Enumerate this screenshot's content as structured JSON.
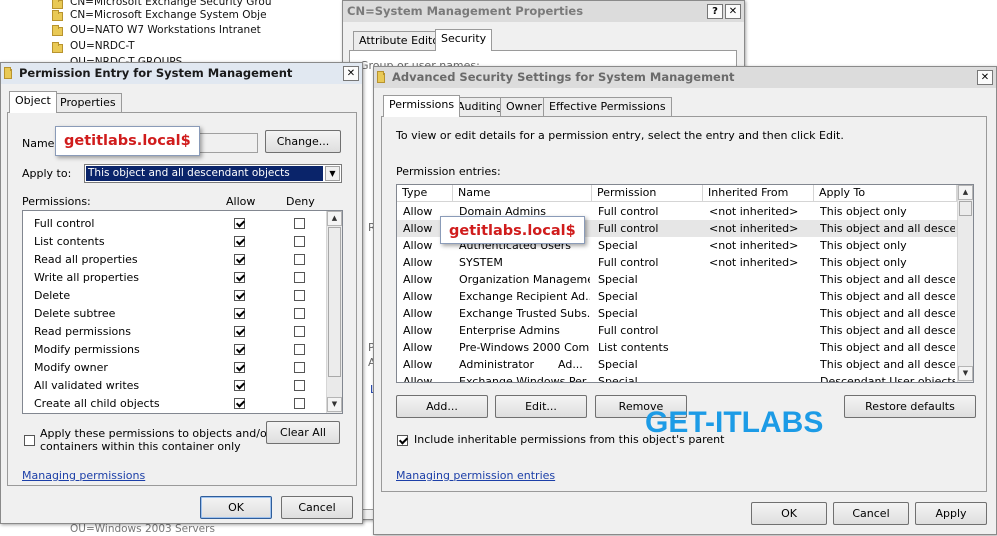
{
  "background_tree": {
    "items": [
      "CN=Microsoft Exchange Security Grou",
      "CN=Microsoft Exchange System Obje",
      "OU=NATO W7 Workstations Intranet",
      "OU=NRDC-T",
      "OU=NRDC-T GROUPS"
    ],
    "bottom_item": "OU=Windows 2003 Servers"
  },
  "back_dialog": {
    "title": "CN=System Management Properties",
    "tabs": [
      "Attribute Editor",
      "Security"
    ],
    "group_label": "Group or user names:"
  },
  "perm_entry": {
    "title": "Permission Entry for System Management",
    "tabs": [
      "Object",
      "Properties"
    ],
    "name_label": "Name:",
    "name_value": "getitlabs.local$",
    "change_button": "Change...",
    "apply_to_label": "Apply to:",
    "apply_to_value": "This object and all descendant objects",
    "permissions_label": "Permissions:",
    "allow_header": "Allow",
    "deny_header": "Deny",
    "permissions": [
      {
        "name": "Full control",
        "allow": true,
        "deny": false
      },
      {
        "name": "List contents",
        "allow": true,
        "deny": false
      },
      {
        "name": "Read all properties",
        "allow": true,
        "deny": false
      },
      {
        "name": "Write all properties",
        "allow": true,
        "deny": false
      },
      {
        "name": "Delete",
        "allow": true,
        "deny": false
      },
      {
        "name": "Delete subtree",
        "allow": true,
        "deny": false
      },
      {
        "name": "Read permissions",
        "allow": true,
        "deny": false
      },
      {
        "name": "Modify permissions",
        "allow": true,
        "deny": false
      },
      {
        "name": "Modify owner",
        "allow": true,
        "deny": false
      },
      {
        "name": "All validated writes",
        "allow": true,
        "deny": false
      },
      {
        "name": "Create all child objects",
        "allow": true,
        "deny": false
      }
    ],
    "apply_checkbox_label_1": "Apply these permissions to objects and/or",
    "apply_checkbox_label_2": "containers within this container only",
    "clear_all_button": "Clear All",
    "managing_link": "Managing permissions",
    "ok_button": "OK",
    "cancel_button": "Cancel"
  },
  "advanced": {
    "title": "Advanced Security Settings for System Management",
    "tabs": [
      "Permissions",
      "Auditing",
      "Owner",
      "Effective Permissions"
    ],
    "instructions": "To view or edit details for a permission entry, select the entry and then click Edit.",
    "entries_label": "Permission entries:",
    "columns": [
      "Type",
      "Name",
      "Permission",
      "Inherited From",
      "Apply To"
    ],
    "rows": [
      {
        "type": "Allow",
        "name": "Domain Admins",
        "permission": "Full control",
        "inherited": "<not inherited>",
        "apply": "This object only"
      },
      {
        "type": "Allow",
        "name": "",
        "permission": "Full control",
        "inherited": "<not inherited>",
        "apply": "This object and all desce..."
      },
      {
        "type": "Allow",
        "name": "Authenticated Users",
        "permission": "Special",
        "inherited": "<not inherited>",
        "apply": "This object only"
      },
      {
        "type": "Allow",
        "name": "SYSTEM",
        "permission": "Full control",
        "inherited": "<not inherited>",
        "apply": "This object only"
      },
      {
        "type": "Allow",
        "name": "Organization Manageme...",
        "permission": "Special",
        "inherited": "",
        "apply": "This object and all desce..."
      },
      {
        "type": "Allow",
        "name": "Exchange Recipient Ad...",
        "permission": "Special",
        "inherited": "",
        "apply": "This object and all desce..."
      },
      {
        "type": "Allow",
        "name": "Exchange Trusted Subs...",
        "permission": "Special",
        "inherited": "",
        "apply": "This object and all desce..."
      },
      {
        "type": "Allow",
        "name": "Enterprise Admins",
        "permission": "Full control",
        "inherited": "",
        "apply": "This object and all desce..."
      },
      {
        "type": "Allow",
        "name": "Pre-Windows 2000 Com...",
        "permission": "List contents",
        "inherited": "",
        "apply": "This object and all desce..."
      },
      {
        "type": "Allow",
        "name": "Administrator",
        "permission": "Special",
        "inherited": "",
        "apply": "This object and all desce..."
      },
      {
        "type": "Allow",
        "name": "Exchange Windows Per...",
        "permission": "Special",
        "inherited": "",
        "apply": "Descendant User objects"
      }
    ],
    "name_extra": "Ad...",
    "add_button": "Add...",
    "edit_button": "Edit...",
    "remove_button": "Remove",
    "restore_button": "Restore defaults",
    "include_inheritable_label": "Include inheritable permissions from this object's parent",
    "managing_link": "Managing permission entries",
    "ok_button": "OK",
    "cancel_button": "Cancel",
    "apply_button": "Apply"
  },
  "callout_text": "getitlabs.local$",
  "watermark": "GET-ITLABS"
}
